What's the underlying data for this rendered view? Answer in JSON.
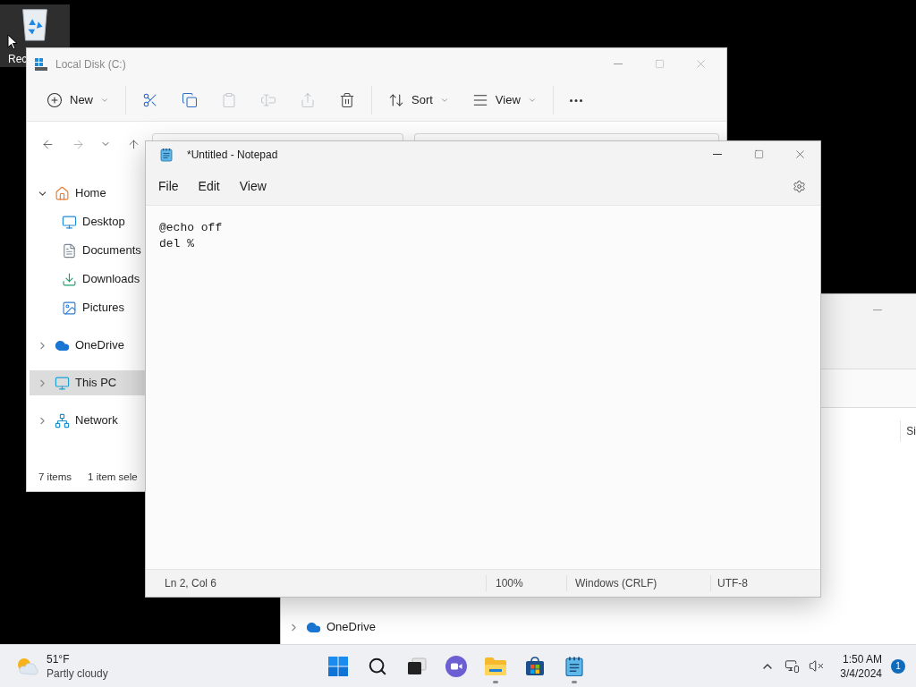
{
  "desktop": {
    "icons": [
      {
        "kind": "recycle-bin",
        "label": "Rec",
        "selected": true
      }
    ]
  },
  "explorer": {
    "title": "Local Disk (C:)",
    "toolbar": [
      {
        "kind": "new",
        "label": "New",
        "disabled": false
      },
      {
        "kind": "cut",
        "disabled": false
      },
      {
        "kind": "copy",
        "disabled": false
      },
      {
        "kind": "paste",
        "disabled": true
      },
      {
        "kind": "rename",
        "disabled": true
      },
      {
        "kind": "share",
        "disabled": true
      },
      {
        "kind": "delete",
        "disabled": false
      },
      {
        "kind": "sort",
        "label": "Sort",
        "disabled": false
      },
      {
        "kind": "view",
        "label": "View",
        "disabled": false
      },
      {
        "kind": "more",
        "disabled": false
      }
    ],
    "nav_tree": [
      {
        "kind": "home",
        "label": "Home",
        "expanded": true,
        "selected": false,
        "children": [
          {
            "kind": "desktop",
            "label": "Desktop",
            "selected": false
          },
          {
            "kind": "documents",
            "label": "Documents",
            "selected": false
          },
          {
            "kind": "downloads",
            "label": "Downloads",
            "selected": false
          },
          {
            "kind": "pictures",
            "label": "Pictures",
            "selected": false
          }
        ]
      },
      {
        "kind": "onedrive",
        "label": "OneDrive",
        "expanded": false,
        "selected": false
      },
      {
        "kind": "thispc",
        "label": "This PC",
        "expanded": false,
        "selected": true
      },
      {
        "kind": "network",
        "label": "Network",
        "expanded": false,
        "selected": false
      }
    ],
    "status_bar": [
      "7 items",
      "1 item sele"
    ]
  },
  "explorer_behind": {
    "column_2_header": "Si",
    "nav_item": {
      "kind": "onedrive",
      "label": "OneDrive",
      "expanded": false
    }
  },
  "notepad": {
    "title": "*Untitled - Notepad",
    "menu": [
      "File",
      "Edit",
      "View"
    ],
    "text": "@echo off\ndel %",
    "status_bar": {
      "position": "Ln 2, Col 6",
      "zoom": "100%",
      "line_endings": "Windows (CRLF)",
      "encoding": "UTF-8"
    }
  },
  "taskbar": {
    "weather": {
      "temperature": "51°F",
      "condition": "Partly cloudy"
    },
    "apps": [
      {
        "kind": "start",
        "running": false
      },
      {
        "kind": "search",
        "running": false
      },
      {
        "kind": "task-view",
        "running": false
      },
      {
        "kind": "chat",
        "running": false
      },
      {
        "kind": "file-explorer",
        "running": true
      },
      {
        "kind": "store",
        "running": false
      },
      {
        "kind": "notepad",
        "running": true
      }
    ],
    "time": "1:50 AM",
    "date": "3/4/2024",
    "notification_count": "1"
  }
}
